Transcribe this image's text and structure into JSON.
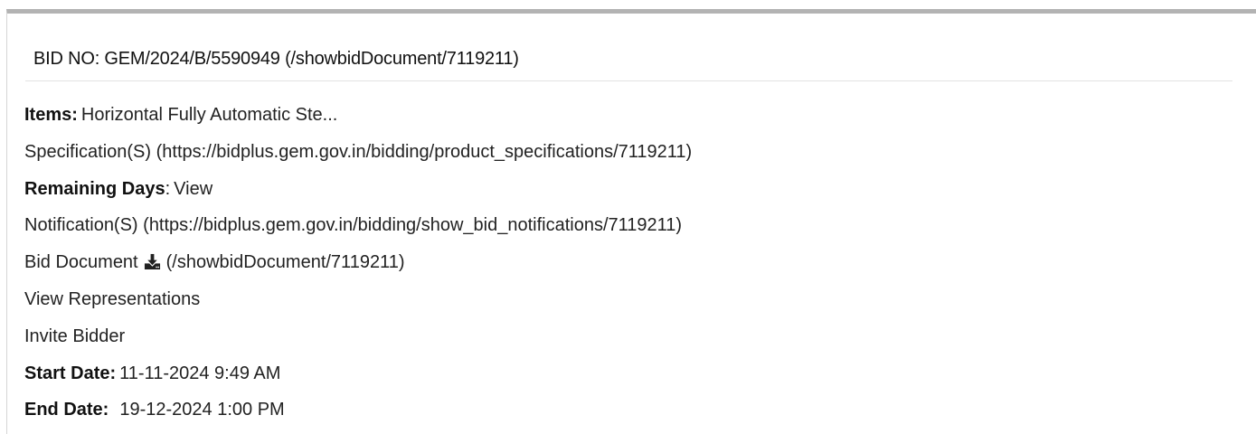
{
  "bid": {
    "title": "BID NO: GEM/2024/B/5590949 (/showbidDocument/7119211)"
  },
  "details": {
    "items_label": "Items:",
    "items_value": "Horizontal Fully Automatic Ste...",
    "specification_link": "Specification(S) (https://bidplus.gem.gov.in/bidding/product_specifications/7119211)",
    "remaining_days_label": "Remaining Days",
    "remaining_days_sep": ":",
    "remaining_days_value": "View",
    "notification_link": "Notification(S) (https://bidplus.gem.gov.in/bidding/show_bid_notifications/7119211)",
    "bid_document_label": "Bid Document",
    "bid_document_icon": "download-icon",
    "bid_document_url": "(/showbidDocument/7119211)",
    "view_representations": "View Representations",
    "invite_bidder": "Invite Bidder",
    "start_date_label": "Start Date:",
    "start_date_value": "11-11-2024 9:49 AM",
    "end_date_label": "End Date:",
    "end_date_value": "19-12-2024 1:00 PM"
  },
  "colors": {
    "top_border": "#b3b3b3",
    "text": "#222222"
  }
}
